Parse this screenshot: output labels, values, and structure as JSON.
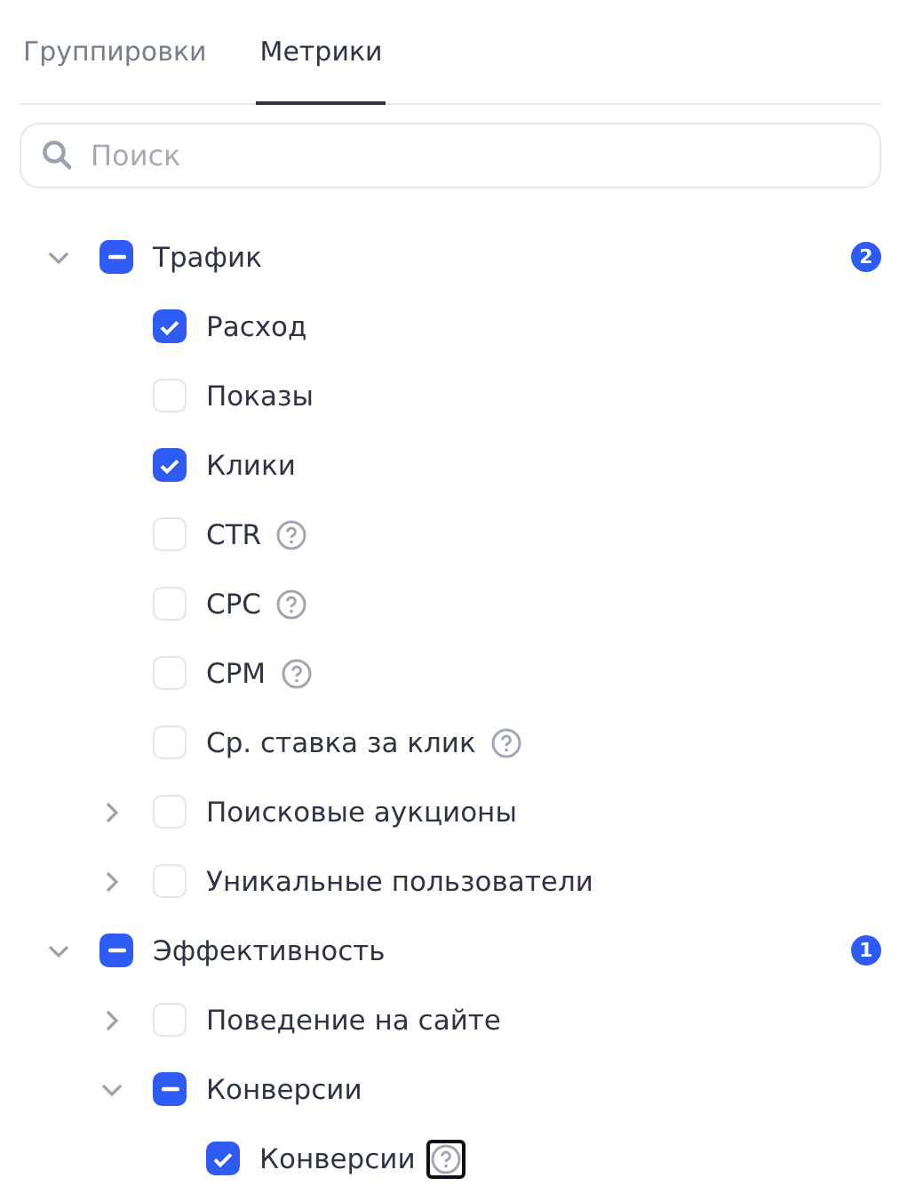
{
  "tabs": [
    {
      "label": "Группировки",
      "selected": false
    },
    {
      "label": "Метрики",
      "selected": true
    }
  ],
  "search": {
    "placeholder": "Поиск"
  },
  "tree": [
    {
      "label": "Трафик",
      "checked": true,
      "indeterminate": true,
      "expanded": true,
      "count": "2",
      "children": [
        {
          "label": "Расход",
          "checked": true,
          "indeterminate": false
        },
        {
          "label": "Показы",
          "checked": false,
          "indeterminate": false
        },
        {
          "label": "Клики",
          "checked": true,
          "indeterminate": false
        },
        {
          "label": "CTR",
          "checked": false,
          "indeterminate": false,
          "hint": true,
          "hint_focused": false
        },
        {
          "label": "CPC",
          "checked": false,
          "indeterminate": false,
          "hint": true,
          "hint_focused": false
        },
        {
          "label": "CPM",
          "checked": false,
          "indeterminate": false,
          "hint": true,
          "hint_focused": false
        },
        {
          "label": "Ср. ставка за клик",
          "checked": false,
          "indeterminate": false,
          "hint": true,
          "hint_focused": false
        },
        {
          "label": "Поисковые аукционы",
          "checked": false,
          "indeterminate": false,
          "expanded": false
        },
        {
          "label": "Уникальные пользователи",
          "checked": false,
          "indeterminate": false,
          "expanded": false
        }
      ]
    },
    {
      "label": "Эффективность",
      "checked": true,
      "indeterminate": true,
      "expanded": true,
      "count": "1",
      "children": [
        {
          "label": "Поведение на сайте",
          "checked": false,
          "indeterminate": false,
          "expanded": false
        },
        {
          "label": "Конверсии",
          "checked": true,
          "indeterminate": true,
          "expanded": true,
          "children": [
            {
              "label": "Конверсии",
              "checked": true,
              "indeterminate": false,
              "hint": true,
              "hint_focused": true
            }
          ]
        }
      ]
    }
  ]
}
